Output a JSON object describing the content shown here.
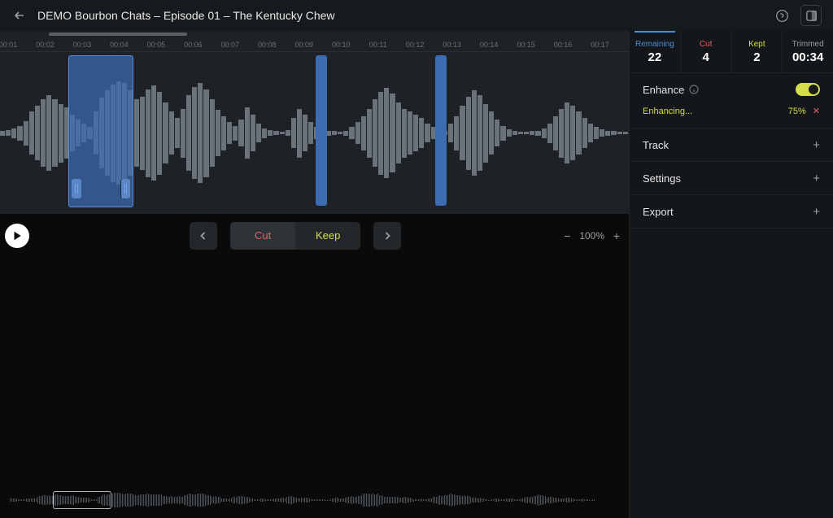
{
  "header": {
    "title": "DEMO Bourbon Chats – Episode 01 – The Kentucky Chew"
  },
  "stats": {
    "remaining": {
      "label": "Remaining",
      "value": "22",
      "color": "#4a8fd6"
    },
    "cut": {
      "label": "Cut",
      "value": "4",
      "color": "#e06262"
    },
    "kept": {
      "label": "Kept",
      "value": "2",
      "color": "#d4df4a"
    },
    "trimmed": {
      "label": "Trimmed",
      "value": "00:34",
      "color": "#9aa0a5"
    }
  },
  "controls": {
    "cut": "Cut",
    "keep": "Keep",
    "zoom": "100%"
  },
  "timeline": {
    "ticks": [
      "00:01",
      "00:02",
      "00:03",
      "00:04",
      "00:05",
      "00:06",
      "00:07",
      "00:08",
      "00:09",
      "00:10",
      "00:11",
      "00:12",
      "00:13",
      "00:14",
      "00:15",
      "00:16",
      "00:17"
    ]
  },
  "right": {
    "enhance": {
      "title": "Enhance",
      "status": "Enhancing...",
      "pct": "75%"
    },
    "track": "Track",
    "settings": "Settings",
    "export": "Export"
  },
  "chart_data": {
    "type": "waveform",
    "note": "Approximate amplitude envelope (0-100) of the main waveform display, sampled across visible width. Centerline at ~0; values represent peak amplitude.",
    "x_ticks": [
      "00:01",
      "00:02",
      "00:03",
      "00:04",
      "00:05",
      "00:06",
      "00:07",
      "00:08",
      "00:09",
      "00:10",
      "00:11",
      "00:12",
      "00:13",
      "00:14",
      "00:15",
      "00:16",
      "00:17"
    ],
    "values": [
      4,
      5,
      8,
      12,
      20,
      35,
      45,
      55,
      62,
      55,
      48,
      42,
      30,
      22,
      15,
      10,
      35,
      58,
      70,
      80,
      85,
      82,
      70,
      55,
      60,
      72,
      78,
      68,
      50,
      35,
      25,
      40,
      62,
      75,
      82,
      72,
      55,
      38,
      28,
      18,
      12,
      22,
      42,
      30,
      15,
      8,
      5,
      3,
      2,
      5,
      25,
      40,
      30,
      18,
      10,
      6,
      4,
      3,
      2,
      4,
      10,
      18,
      28,
      40,
      55,
      68,
      74,
      65,
      50,
      40,
      35,
      30,
      25,
      15,
      10,
      6,
      3,
      15,
      28,
      45,
      60,
      70,
      62,
      48,
      35,
      22,
      12,
      6,
      3,
      2,
      2,
      3,
      4,
      8,
      16,
      28,
      40,
      50,
      45,
      35,
      25,
      15,
      10,
      6,
      4,
      3,
      2,
      2
    ],
    "selections": [
      {
        "start_tick": "00:03",
        "end_tick": "00:04",
        "role": "primary"
      },
      {
        "start_tick": "00:09",
        "end_tick": "00:09.3",
        "role": "marker"
      },
      {
        "start_tick": "00:12",
        "end_tick": "00:12.3",
        "role": "marker"
      }
    ]
  }
}
